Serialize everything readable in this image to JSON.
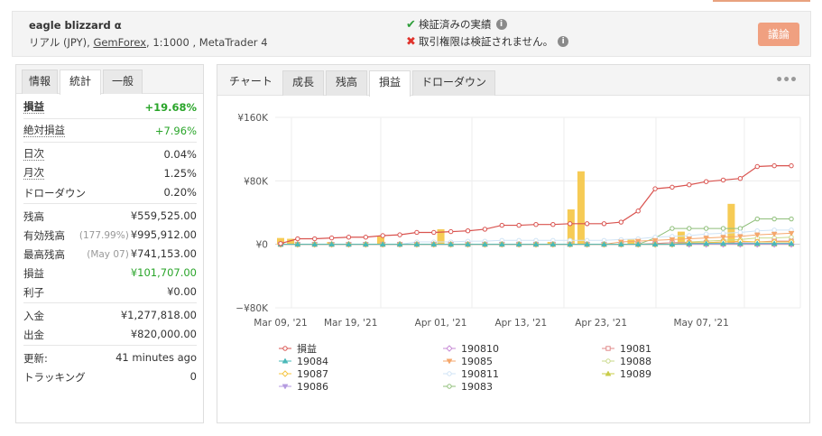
{
  "header": {
    "account_name": "eagle blizzard α",
    "account_type": "リアル (JPY), ",
    "broker": "GemForex",
    "account_details": ", 1:1000 , MetaTrader 4",
    "verified_track_record": "検証済みの実績",
    "trading_privileges": "取引権限は検証されません。",
    "discuss_button": "議論"
  },
  "left_tabs": [
    "情報",
    "統計",
    "一般"
  ],
  "stats": {
    "gain": {
      "label": "損益",
      "value": "+19.68%"
    },
    "abs_gain": {
      "label": "絶対損益",
      "value": "+7.96%"
    },
    "daily": {
      "label": "日次",
      "value": "0.04%"
    },
    "monthly": {
      "label": "月次",
      "value": "1.25%"
    },
    "drawdown": {
      "label": "ドローダウン",
      "value": "0.20%"
    },
    "balance": {
      "label": "残高",
      "value": "¥559,525.00"
    },
    "equity": {
      "label": "有効残高",
      "note": "(177.99%)",
      "value": "¥995,912.00"
    },
    "highest": {
      "label": "最高残高",
      "note": "(May 07)",
      "value": "¥741,153.00"
    },
    "profit": {
      "label": "損益",
      "value": "¥101,707.00"
    },
    "interest": {
      "label": "利子",
      "value": "¥0.00"
    },
    "deposits": {
      "label": "入金",
      "value": "¥1,277,818.00"
    },
    "withdrawals": {
      "label": "出金",
      "value": "¥820,000.00"
    },
    "updated": {
      "label": "更新:",
      "value": "41 minutes ago"
    },
    "tracking": {
      "label": "トラッキング",
      "value": "0"
    }
  },
  "chart_tabs": [
    "チャート",
    "成長",
    "残高",
    "損益",
    "ドローダウン"
  ],
  "icons": {
    "check": "check-icon",
    "cross": "cross-icon",
    "info": "info-icon",
    "more": "more-icon"
  },
  "colors": {
    "accent_button": "#f0a080",
    "positive": "#2aa52a",
    "bars": "#f5c542"
  },
  "chart_data": {
    "type": "line",
    "title": "",
    "xlabel": "",
    "ylabel": "",
    "x_tick_labels": [
      "Mar 09, '21",
      "Mar 19, '21",
      "Apr 01, '21",
      "Apr 13, '21",
      "Apr 23, '21",
      "May 07, '21"
    ],
    "y_tick_labels": [
      "¥160K",
      "¥80K",
      "¥0",
      "−¥80K"
    ],
    "ylim": [
      -80000,
      160000
    ],
    "x": [
      "Mar 09",
      "Mar 10",
      "Mar 12",
      "Mar 15",
      "Mar 16",
      "Mar 17",
      "Mar 18",
      "Mar 19",
      "Mar 22",
      "Mar 23",
      "Mar 24",
      "Mar 25",
      "Mar 26",
      "Mar 29",
      "Mar 30",
      "Mar 31",
      "Apr 01",
      "Apr 02",
      "Apr 05",
      "Apr 06",
      "Apr 07",
      "Apr 08",
      "Apr 09",
      "Apr 12",
      "Apr 13",
      "Apr 14",
      "Apr 15",
      "Apr 16",
      "Apr 19",
      "Apr 20",
      "Apr 21",
      "Apr 22",
      "Apr 23",
      "Apr 26",
      "Apr 27",
      "Apr 28",
      "Apr 29",
      "Apr 30",
      "May 03",
      "May 04",
      "May 05",
      "May 06",
      "May 07",
      "May 10",
      "May 11",
      "May 12",
      "May 13",
      "May 14",
      "May 17",
      "May 18",
      "May 19",
      "May 20"
    ],
    "bar_series": {
      "name": "daily",
      "values": [
        {
          "x": "Mar 09",
          "y": 8000
        },
        {
          "x": "Mar 10",
          "y": 7000
        },
        {
          "x": "Mar 17",
          "y": 3000
        },
        {
          "x": "Mar 24",
          "y": 10000
        },
        {
          "x": "Apr 01",
          "y": 19000
        },
        {
          "x": "Apr 16",
          "y": 3000
        },
        {
          "x": "Apr 20",
          "y": 44000
        },
        {
          "x": "Apr 21",
          "y": 92000
        },
        {
          "x": "Apr 28",
          "y": 6000
        },
        {
          "x": "May 05",
          "y": 16000
        },
        {
          "x": "May 12",
          "y": 51000
        }
      ]
    },
    "series": [
      {
        "name": "損益",
        "color": "#d9534f",
        "marker": "circle",
        "values": [
          1000,
          7000,
          7000,
          8000,
          9000,
          9000,
          11000,
          12000,
          15000,
          15000,
          16000,
          17000,
          19000,
          24000,
          24000,
          25000,
          25000,
          26000,
          26000,
          26000,
          28000,
          42000,
          70000,
          72000,
          75000,
          79000,
          81000,
          83000,
          98000,
          99000,
          99000
        ]
      },
      {
        "name": "19084",
        "color": "#4ab8b8",
        "marker": "triangle",
        "values": [
          0,
          0,
          0,
          0,
          0,
          0,
          0,
          0,
          0,
          0,
          0,
          0,
          0,
          0,
          0,
          0,
          0,
          0,
          0,
          0,
          0,
          0,
          0,
          0,
          1000,
          1000,
          1000,
          1000,
          1000,
          1000,
          1000
        ]
      },
      {
        "name": "19087",
        "color": "#f5c542",
        "marker": "diamond",
        "values": [
          0,
          0,
          0,
          0,
          0,
          0,
          0,
          0,
          0,
          0,
          0,
          0,
          0,
          0,
          0,
          0,
          0,
          0,
          0,
          0,
          0,
          0,
          0,
          0,
          2000,
          2000,
          3000,
          4000,
          3000,
          3000,
          3000
        ]
      },
      {
        "name": "19086",
        "color": "#b59be0",
        "marker": "triangle-down",
        "values": [
          0,
          0,
          0,
          0,
          0,
          0,
          0,
          0,
          0,
          0,
          0,
          0,
          0,
          0,
          0,
          0,
          0,
          0,
          0,
          0,
          0,
          0,
          0,
          0,
          0,
          1000,
          1000,
          1000,
          1000,
          1000,
          1000
        ]
      },
      {
        "name": "190810",
        "color": "#c78bd6",
        "marker": "diamond",
        "values": [
          0,
          0,
          0,
          0,
          0,
          0,
          0,
          0,
          0,
          0,
          0,
          0,
          0,
          0,
          0,
          0,
          0,
          0,
          0,
          0,
          0,
          0,
          0,
          0,
          0,
          0,
          0,
          0,
          0,
          0,
          0
        ]
      },
      {
        "name": "19085",
        "color": "#f5a76c",
        "marker": "triangle-down",
        "values": [
          0,
          0,
          0,
          0,
          0,
          0,
          0,
          0,
          0,
          0,
          0,
          0,
          0,
          0,
          0,
          0,
          0,
          0,
          0,
          0,
          3000,
          4000,
          5000,
          6000,
          7000,
          8000,
          9000,
          10000,
          12000,
          13000,
          14000
        ]
      },
      {
        "name": "190811",
        "color": "#cfe3f5",
        "marker": "circle",
        "values": [
          0,
          0,
          0,
          0,
          0,
          0,
          0,
          0,
          3000,
          3000,
          3000,
          4000,
          4000,
          5000,
          5000,
          5000,
          5000,
          5000,
          5000,
          5000,
          6000,
          7000,
          9000,
          10000,
          11000,
          13000,
          14000,
          15000,
          17000,
          18000,
          18000
        ]
      },
      {
        "name": "19083",
        "color": "#8fbf7a",
        "marker": "circle",
        "values": [
          0,
          0,
          0,
          0,
          0,
          0,
          0,
          0,
          0,
          0,
          0,
          0,
          0,
          0,
          0,
          0,
          0,
          0,
          0,
          0,
          0,
          0,
          8000,
          20000,
          20000,
          20000,
          20000,
          20000,
          32000,
          32000,
          32000
        ]
      },
      {
        "name": "19081",
        "color": "#e08a8a",
        "marker": "square",
        "values": [
          0,
          0,
          0,
          0,
          0,
          0,
          0,
          0,
          0,
          0,
          0,
          0,
          0,
          0,
          0,
          0,
          0,
          0,
          0,
          0,
          0,
          0,
          1000,
          2000,
          2000,
          2000,
          3000,
          3000,
          3000,
          4000,
          4000
        ]
      },
      {
        "name": "19088",
        "color": "#c9d98a",
        "marker": "circle",
        "values": [
          0,
          0,
          0,
          0,
          0,
          0,
          0,
          0,
          0,
          0,
          0,
          0,
          0,
          0,
          0,
          0,
          0,
          0,
          0,
          0,
          0,
          0,
          1000,
          2000,
          3000,
          4000,
          5000,
          6000,
          8000,
          8000,
          9000
        ]
      },
      {
        "name": "19089",
        "color": "#c9cc4a",
        "marker": "triangle",
        "values": [
          0,
          0,
          0,
          0,
          0,
          0,
          0,
          0,
          0,
          0,
          0,
          0,
          0,
          0,
          0,
          0,
          0,
          0,
          0,
          0,
          0,
          0,
          0,
          0,
          0,
          0,
          0,
          0,
          0,
          0,
          0
        ]
      }
    ],
    "legend_order": [
      "損益",
      "190810",
      "19081",
      "19084",
      "19085",
      "19088",
      "19087",
      "190811",
      "19089",
      "19086",
      "19083"
    ],
    "grid": true,
    "legend_position": "bottom"
  }
}
